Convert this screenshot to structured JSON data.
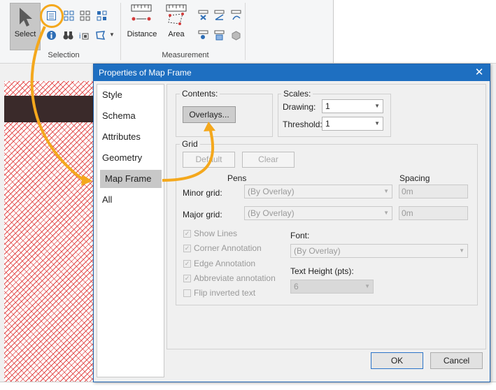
{
  "ribbon": {
    "select_label": "Select",
    "selection_group": "Selection",
    "distance_label": "Distance",
    "area_label": "Area",
    "measurement_group": "Measurement"
  },
  "dialog": {
    "title": "Properties of Map Frame",
    "close": "✕",
    "nav": [
      "Style",
      "Schema",
      "Attributes",
      "Geometry",
      "Map Frame",
      "All"
    ],
    "selected_nav": "Map Frame",
    "contents": {
      "label": "Contents:",
      "overlays_button": "Overlays..."
    },
    "scales": {
      "label": "Scales:",
      "drawing_label": "Drawing:",
      "drawing_value": "1",
      "threshold_label": "Threshold:",
      "threshold_value": "1"
    },
    "grid": {
      "label": "Grid",
      "default_button": "Default",
      "clear_button": "Clear",
      "pens_header": "Pens",
      "spacing_header": "Spacing",
      "minor_label": "Minor grid:",
      "minor_pen": "(By Overlay)",
      "minor_spacing": "0m",
      "major_label": "Major grid:",
      "major_pen": "(By Overlay)",
      "major_spacing": "0m",
      "checkboxes": [
        {
          "label": "Show Lines",
          "checked": true
        },
        {
          "label": "Corner Annotation",
          "checked": true
        },
        {
          "label": "Edge Annotation",
          "checked": true
        },
        {
          "label": "Abbreviate annotation",
          "checked": true
        },
        {
          "label": "Flip inverted text",
          "checked": false
        }
      ],
      "font_label": "Font:",
      "font_value": "(By Overlay)",
      "text_height_label": "Text Height (pts):",
      "text_height_value": "6"
    },
    "ok_button": "OK",
    "cancel_button": "Cancel"
  },
  "colors": {
    "accent": "#1e6fc1",
    "annotation": "#f4a81d",
    "map_hatch": "#dc2828"
  }
}
